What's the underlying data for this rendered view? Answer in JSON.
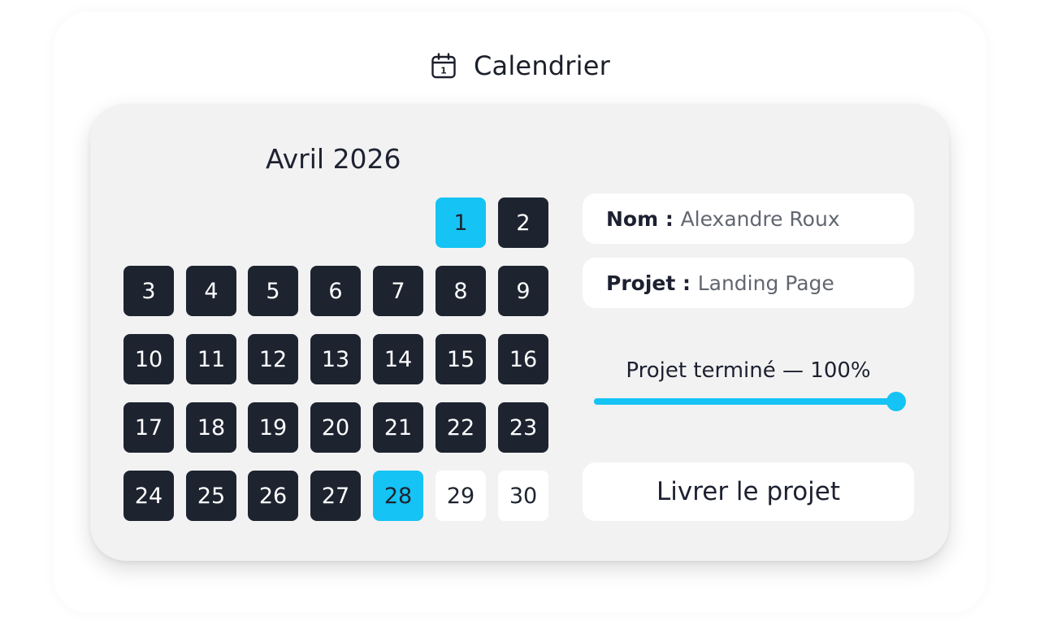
{
  "header": {
    "title": "Calendrier",
    "icon": "calendar-icon",
    "icon_day": "1"
  },
  "calendar": {
    "month_label": "Avril 2026",
    "days": [
      {
        "label": "1",
        "style": "accent"
      },
      {
        "label": "2",
        "style": "dark"
      },
      {
        "label": "3",
        "style": "dark"
      },
      {
        "label": "4",
        "style": "dark"
      },
      {
        "label": "5",
        "style": "dark"
      },
      {
        "label": "6",
        "style": "dark"
      },
      {
        "label": "7",
        "style": "dark"
      },
      {
        "label": "8",
        "style": "dark"
      },
      {
        "label": "9",
        "style": "dark"
      },
      {
        "label": "10",
        "style": "dark"
      },
      {
        "label": "11",
        "style": "dark"
      },
      {
        "label": "12",
        "style": "dark"
      },
      {
        "label": "13",
        "style": "dark"
      },
      {
        "label": "14",
        "style": "dark"
      },
      {
        "label": "15",
        "style": "dark"
      },
      {
        "label": "16",
        "style": "dark"
      },
      {
        "label": "17",
        "style": "dark"
      },
      {
        "label": "18",
        "style": "dark"
      },
      {
        "label": "19",
        "style": "dark"
      },
      {
        "label": "20",
        "style": "dark"
      },
      {
        "label": "21",
        "style": "dark"
      },
      {
        "label": "22",
        "style": "dark"
      },
      {
        "label": "23",
        "style": "dark"
      },
      {
        "label": "24",
        "style": "dark"
      },
      {
        "label": "25",
        "style": "dark"
      },
      {
        "label": "26",
        "style": "dark"
      },
      {
        "label": "27",
        "style": "dark"
      },
      {
        "label": "28",
        "style": "accent"
      },
      {
        "label": "29",
        "style": "light"
      },
      {
        "label": "30",
        "style": "light"
      }
    ]
  },
  "info": {
    "name_label": "Nom",
    "name_value": "Alexandre Roux",
    "project_label": "Projet",
    "project_value": "Landing Page",
    "separator": " : "
  },
  "progress": {
    "label": "Projet terminé — 100%",
    "value": 1.0
  },
  "actions": {
    "deliver_label": "Livrer le projet"
  },
  "colors": {
    "accent": "#15c3f4",
    "dark_day": "#1d2430",
    "card_bg": "#f2f2f2",
    "pill_bg": "#ffffff"
  }
}
